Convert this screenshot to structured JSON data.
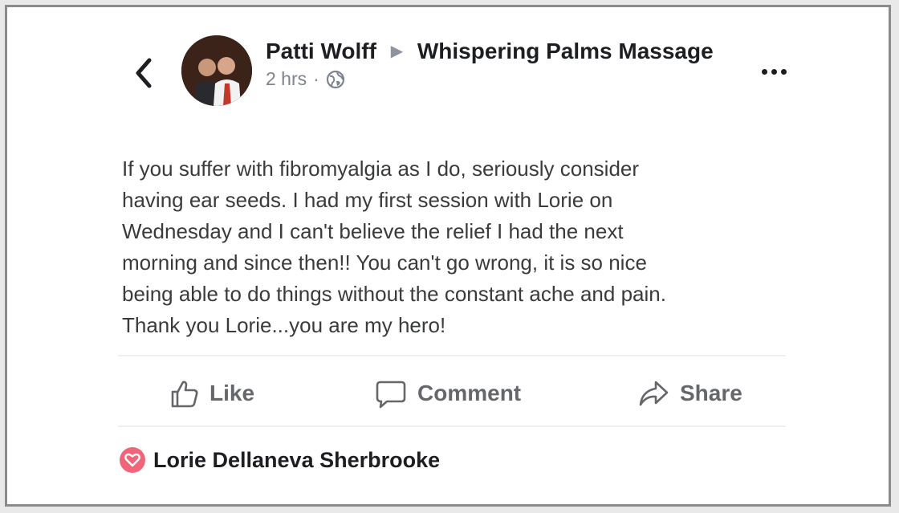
{
  "post": {
    "author": "Patti Wolff",
    "page_name": "Whispering Palms Massage",
    "time": "2 hrs",
    "separator": "·",
    "privacy_icon": "globe-icon",
    "body": "If you suffer with fibromyalgia as I do, seriously consider\nhaving ear seeds. I had my first session with Lorie on\nWednesday and I can't believe the relief I had the next\nmorning and since then!! You can't go wrong, it is so nice\nbeing able to do things without the constant ache and pain.\nThank you Lorie...you are my hero!"
  },
  "actions": {
    "like_label": "Like",
    "comment_label": "Comment",
    "share_label": "Share"
  },
  "reactions": {
    "reactor_name": "Lorie Dellaneva Sherbrooke",
    "reaction_icon": "heart-icon",
    "reaction_color": "#f1657b"
  },
  "icons": {
    "back": "back-chevron-icon",
    "more": "more-options-icon",
    "like": "thumbs-up-icon",
    "comment": "speech-bubble-icon",
    "share": "share-arrow-icon"
  }
}
